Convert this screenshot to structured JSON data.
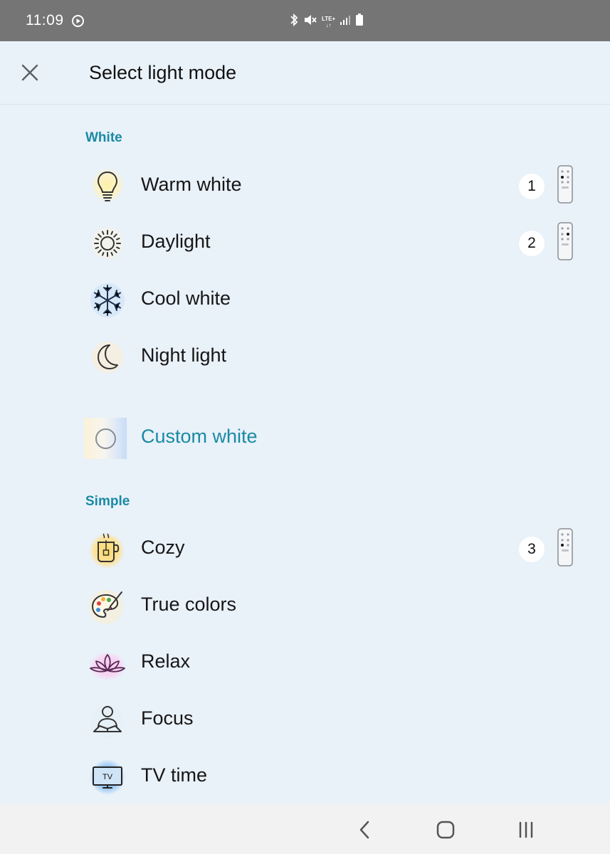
{
  "status_bar": {
    "time": "11:09",
    "network": "LTE+"
  },
  "header": {
    "title": "Select light mode"
  },
  "sections": {
    "white": {
      "title": "White",
      "items": [
        {
          "label": "Warm white",
          "icon": "light-bulb-icon",
          "badge": "1"
        },
        {
          "label": "Daylight",
          "icon": "sun-icon",
          "badge": "2"
        },
        {
          "label": "Cool white",
          "icon": "snowflake-icon"
        },
        {
          "label": "Night light",
          "icon": "moon-icon"
        }
      ],
      "custom": {
        "label": "Custom white"
      }
    },
    "simple": {
      "title": "Simple",
      "items": [
        {
          "label": "Cozy",
          "icon": "tea-cup-icon",
          "badge": "3"
        },
        {
          "label": "True colors",
          "icon": "palette-icon"
        },
        {
          "label": "Relax",
          "icon": "lotus-icon"
        },
        {
          "label": "Focus",
          "icon": "person-reading-icon"
        },
        {
          "label": "TV time",
          "icon": "tv-icon",
          "icon_text": "TV"
        }
      ]
    }
  },
  "colors": {
    "accent": "#1a8aa4",
    "background": "#e9f1f9",
    "status_bar": "#757575",
    "nav_bar": "#f2f2f2"
  }
}
